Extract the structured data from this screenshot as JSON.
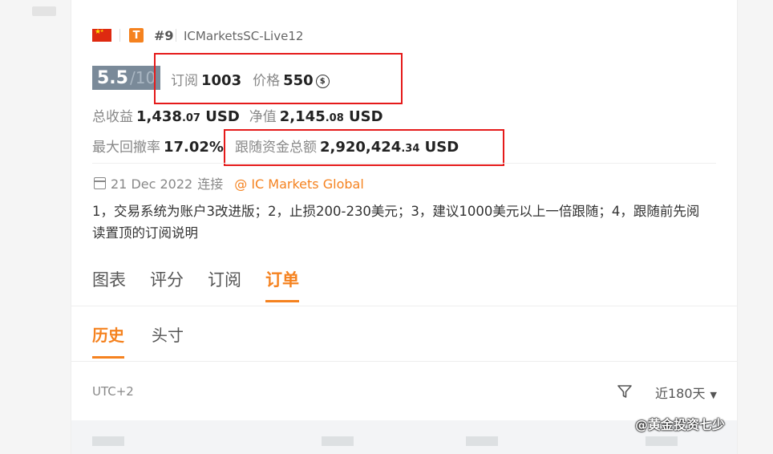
{
  "header": {
    "rank": "#9",
    "badge": "T",
    "server": "ICMarketsSC-Live12"
  },
  "score": {
    "value": "5.5",
    "max": "/10"
  },
  "subscribe": {
    "label": "订阅",
    "value": "1003"
  },
  "price": {
    "label": "价格",
    "value": "550",
    "coin_icon": "currency-coin-icon"
  },
  "total_profit": {
    "label": "总收益",
    "int": "1,438",
    "dec": ".07",
    "unit": "USD"
  },
  "equity": {
    "label": "净值",
    "int": "2,145",
    "dec": ".08",
    "unit": "USD"
  },
  "max_drawdown": {
    "label": "最大回撤率",
    "value": "17.02%"
  },
  "follow_total": {
    "label": "跟随资金总额",
    "int": "2,920,424",
    "dec": ".34",
    "unit": "USD"
  },
  "connect": {
    "date": "21 Dec 2022",
    "label": "连接",
    "broker": "@ IC Markets Global"
  },
  "description": "1，交易系统为账户3改进版；2，止损200-230美元；3，建议1000美元以上一倍跟随；4，跟随前先阅读置顶的订阅说明",
  "tabs": [
    "图表",
    "评分",
    "订阅",
    "订单"
  ],
  "subtabs": [
    "历史",
    "头寸"
  ],
  "timezone": "UTC+2",
  "period": "近180天",
  "watermark": "@黄金投资七少",
  "colors": {
    "accent": "#f5821f",
    "highlight_box": "#e51a1a",
    "score_bg": "#7a8a99"
  }
}
